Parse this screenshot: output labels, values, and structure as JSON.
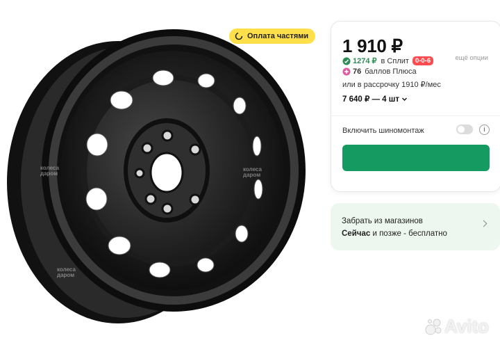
{
  "badge": {
    "label": "Оплата частями"
  },
  "offer": {
    "price": "1 910 ₽",
    "more_options": "ещё опции",
    "split": {
      "price": "1274 ₽",
      "text": "в Сплит",
      "tag": "0-0-6"
    },
    "plus": {
      "points": "76",
      "text": "баллов Плюса"
    },
    "installment": "или в рассрочку 1910 ₽/мес",
    "bulk_price": "7 640 ₽ — 4 шт",
    "tire_fitting_label": "Включить шиномонтаж",
    "tire_fitting_enabled": false,
    "buy_button_label": ""
  },
  "pickup": {
    "title": "Забрать из магазинов",
    "now": "Сейчас",
    "later": "и позже - бесплатно"
  },
  "watermarks": {
    "line1": "колеса",
    "line2": "даром"
  },
  "brand": {
    "name": "Avito"
  },
  "colors": {
    "button": "#159a62",
    "badge": "#ffdf4a",
    "split_tag": "#ff4d4f",
    "pickup_bg": "#eef7ef"
  }
}
